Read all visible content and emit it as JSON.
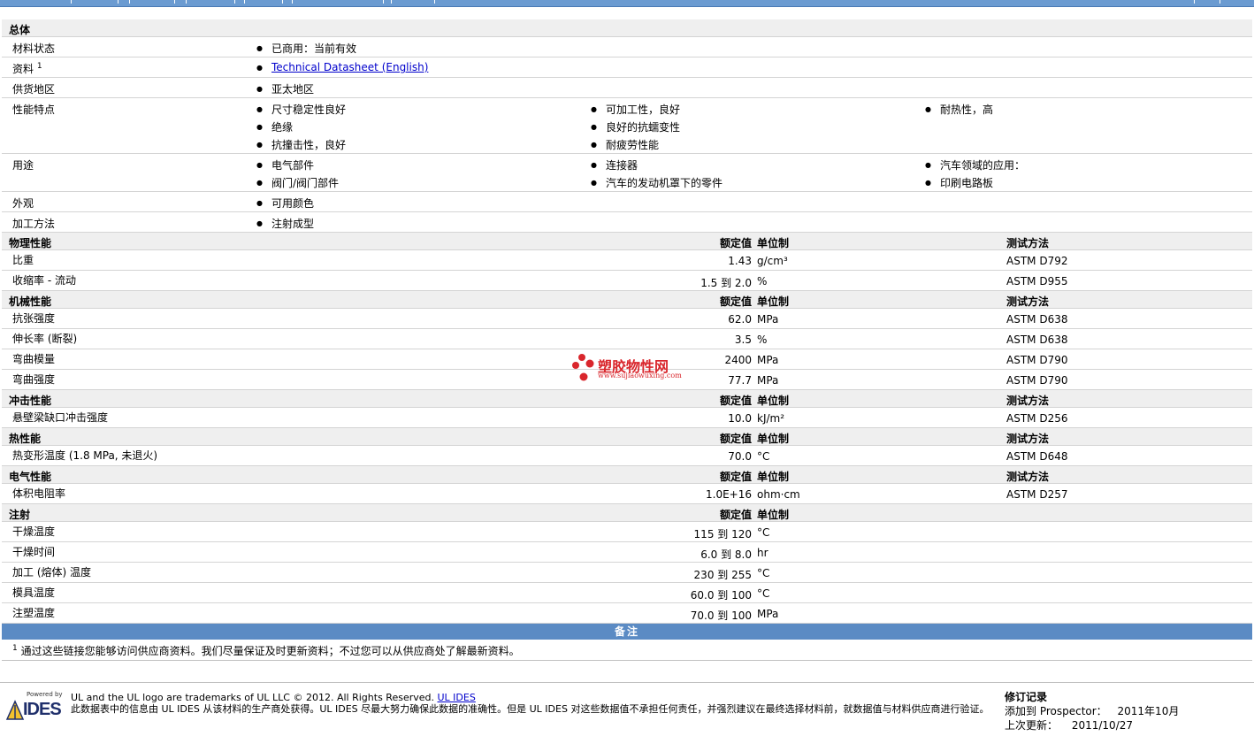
{
  "general": {
    "title": "总体",
    "rows": [
      {
        "label": "材料状态",
        "items": [
          "已商用：当前有效"
        ]
      },
      {
        "label": "资料",
        "sup": "1",
        "link": "Technical Datasheet (English)"
      },
      {
        "label": "供货地区",
        "items": [
          "亚太地区"
        ]
      },
      {
        "label": "性能特点",
        "items": [
          "尺寸稳定性良好",
          "可加工性，良好",
          "耐热性，高",
          "绝缘",
          "良好的抗蠕变性",
          "抗撞击性，良好",
          "耐疲劳性能"
        ]
      },
      {
        "label": "用途",
        "items": [
          "电气部件",
          "连接器",
          "汽车领域的应用：",
          "阀门/阀门部件",
          "汽车的发动机罩下的零件",
          "印刷电路板"
        ]
      },
      {
        "label": "外观",
        "items": [
          "可用颜色"
        ]
      },
      {
        "label": "加工方法",
        "items": [
          "注射成型"
        ]
      }
    ]
  },
  "headers": {
    "value": "额定值",
    "unit": "单位制",
    "method": "测试方法"
  },
  "sections": [
    {
      "title": "物理性能",
      "rows": [
        {
          "label": "比重",
          "value": "1.43",
          "unit": "g/cm³",
          "method": "ASTM D792"
        },
        {
          "label": "收缩率 - 流动",
          "value": "1.5 到  2.0",
          "unit": "%",
          "method": "ASTM D955"
        }
      ]
    },
    {
      "title": "机械性能",
      "rows": [
        {
          "label": "抗张强度",
          "value": "62.0",
          "unit": "MPa",
          "method": "ASTM D638"
        },
        {
          "label": "伸长率 (断裂)",
          "value": "3.5",
          "unit": "%",
          "method": "ASTM D638"
        },
        {
          "label": "弯曲模量",
          "value": "2400",
          "unit": "MPa",
          "method": "ASTM D790"
        },
        {
          "label": "弯曲强度",
          "value": "77.7",
          "unit": "MPa",
          "method": "ASTM D790"
        }
      ]
    },
    {
      "title": "冲击性能",
      "rows": [
        {
          "label": "悬壁梁缺口冲击强度",
          "value": "10.0",
          "unit": "kJ/m²",
          "method": "ASTM D256"
        }
      ]
    },
    {
      "title": "热性能",
      "rows": [
        {
          "label": "热变形温度 (1.8 MPa, 未退火)",
          "value": "70.0",
          "unit": "°C",
          "method": "ASTM D648"
        }
      ]
    },
    {
      "title": "电气性能",
      "rows": [
        {
          "label": "体积电阻率",
          "value": "1.0E+16",
          "unit": "ohm·cm",
          "method": "ASTM D257"
        }
      ]
    },
    {
      "title": "注射",
      "rows": [
        {
          "label": "干燥温度",
          "value": "115 到  120",
          "unit": "°C"
        },
        {
          "label": "干燥时间",
          "value": "6.0 到  8.0",
          "unit": "hr"
        },
        {
          "label": "加工 (熔体) 温度",
          "value": "230 到  255",
          "unit": "°C"
        },
        {
          "label": "模具温度",
          "value": "60.0 到  100",
          "unit": "°C"
        },
        {
          "label": "注塑温度",
          "value": "70.0 到  100",
          "unit": "MPa"
        }
      ]
    }
  ],
  "notes": {
    "title": "备注",
    "sup": "1",
    "text": "通过这些链接您能够访问供应商资料。我们尽量保证及时更新资料；不过您可以从供应商处了解最新资料。"
  },
  "watermark": {
    "cn": "塑胶物性网",
    "en": "www.sujiaowuxing.com"
  },
  "footer": {
    "logo_powered": "Powered by",
    "logo_text": "IDES",
    "line1": "UL and the UL logo are trademarks of UL LLC © 2012. All Rights Reserved.",
    "line1_link": "UL IDES",
    "line2": "此数据表中的信息由 UL IDES 从该材料的生产商处获得。UL IDES 尽最大努力确保此数据的准确性。但是 UL IDES 对这些数据值不承担任何责任，并强烈建议在最终选择材料前，就数据值与材料供应商进行验证。",
    "rev_title": "修订记录",
    "added_label": "添加到 Prospector：",
    "added_value": "2011年10月",
    "updated_label": "上次更新：",
    "updated_value": "2011/10/27"
  },
  "colors": {
    "header_bar": "#6b9bd1",
    "notes_bar": "#5b8bc4",
    "section_bg": "#efefef",
    "link": "#0000cc",
    "watermark": "#d9262c"
  }
}
